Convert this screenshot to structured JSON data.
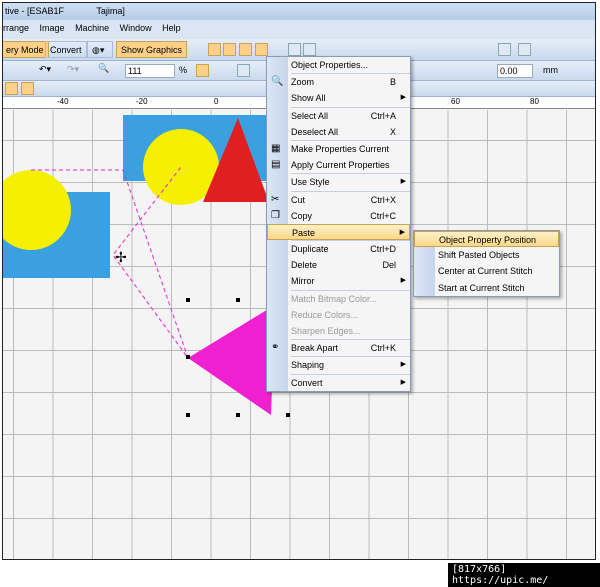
{
  "window": {
    "title_left": "tive - [ESAB1F",
    "title_right": "Tajima]"
  },
  "menubar": [
    "rrange",
    "Image",
    "Machine",
    "Window",
    "Help"
  ],
  "toolbar": {
    "mode_button": "ery Mode",
    "convert_button": "Convert",
    "show_graphics_button": "Show Graphics",
    "zoom_value": "111",
    "zoom_unit": "%",
    "offset_value": "0.00",
    "offset_unit": "mm"
  },
  "ruler": [
    "-40",
    "-20",
    "0",
    "60",
    "80"
  ],
  "context_menu": {
    "items": [
      {
        "label": "Object Properties...",
        "shortcut": ""
      },
      {
        "label": "Zoom",
        "shortcut": "B",
        "icon": "magnifier-icon"
      },
      {
        "label": "Show All",
        "submenu": true
      },
      {
        "label": "Select All",
        "shortcut": "Ctrl+A"
      },
      {
        "label": "Deselect All",
        "shortcut": "X"
      },
      {
        "label": "Make Properties Current",
        "icon": "properties-icon"
      },
      {
        "label": "Apply Current Properties",
        "icon": "apply-icon"
      },
      {
        "label": "Use Style",
        "submenu": true
      },
      {
        "label": "Cut",
        "shortcut": "Ctrl+X",
        "icon": "scissors-icon"
      },
      {
        "label": "Copy",
        "shortcut": "Ctrl+C",
        "icon": "copy-icon"
      },
      {
        "label": "Paste",
        "submenu": true,
        "highlighted": true
      },
      {
        "label": "Duplicate",
        "shortcut": "Ctrl+D"
      },
      {
        "label": "Delete",
        "shortcut": "Del"
      },
      {
        "label": "Mirror",
        "submenu": true
      },
      {
        "label": "Match Bitmap Color...",
        "disabled": true
      },
      {
        "label": "Reduce Colors...",
        "disabled": true
      },
      {
        "label": "Sharpen Edges...",
        "disabled": true
      },
      {
        "label": "Break Apart",
        "shortcut": "Ctrl+K",
        "icon": "break-apart-icon"
      },
      {
        "label": "Shaping",
        "submenu": true
      },
      {
        "label": "Convert",
        "submenu": true
      }
    ]
  },
  "paste_submenu": {
    "items": [
      "Object Property Position",
      "Shift Pasted Objects",
      "Center at Current Stitch",
      "Start at Current Stitch"
    ],
    "highlighted": 0
  },
  "watermark": "[817x766] https://upic.me/",
  "colors": {
    "accent": "#fdd08a",
    "blue_fill": "#3aa0e0",
    "yellow_fill": "#f4f000",
    "red_fill": "#e02020",
    "magenta_fill": "#f020d0"
  }
}
